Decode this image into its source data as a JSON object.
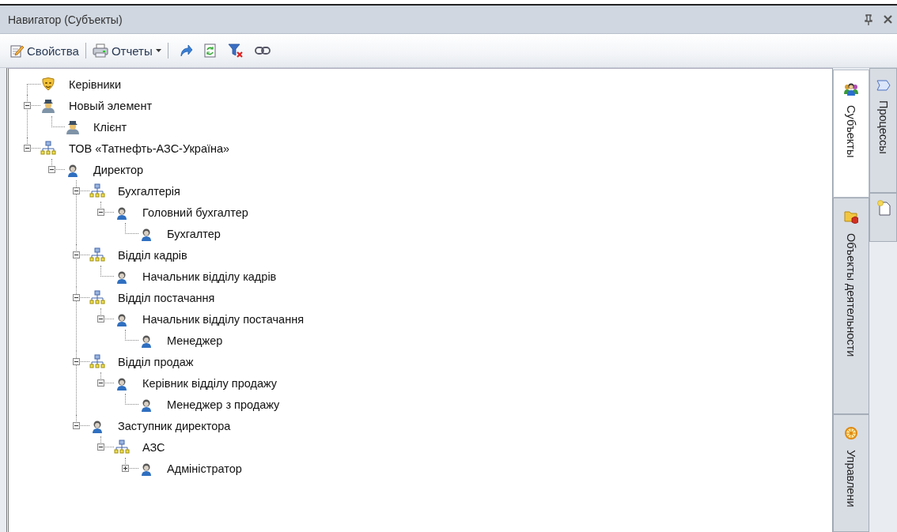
{
  "panel": {
    "title": "Навигатор (Субъекты)"
  },
  "toolbar": [
    {
      "kind": "labeled",
      "label": "Свойства"
    },
    {
      "kind": "dropdown",
      "label": "Отчеты"
    }
  ],
  "tree": [
    {
      "kind": "role",
      "label": "Керівники"
    },
    {
      "kind": "client",
      "label": "Новый элемент",
      "expanded": true,
      "children": [
        {
          "kind": "client",
          "label": "Клієнт"
        }
      ]
    },
    {
      "kind": "unit",
      "label": "ТОВ «Татнефть-АЗС-Україна»",
      "expanded": true,
      "children": [
        {
          "kind": "position",
          "label": "Директор",
          "expanded": true,
          "children": [
            {
              "kind": "unit",
              "label": "Бухгалтерія",
              "expanded": true,
              "children": [
                {
                  "kind": "position",
                  "label": "Головний бухгалтер",
                  "expanded": true,
                  "children": [
                    {
                      "kind": "position",
                      "label": "Бухгалтер"
                    }
                  ]
                }
              ]
            },
            {
              "kind": "unit",
              "label": "Відділ кадрів",
              "expanded": true,
              "children": [
                {
                  "kind": "position",
                  "label": "Начальник відділу кадрів"
                }
              ]
            },
            {
              "kind": "unit",
              "label": "Відділ постачання",
              "expanded": true,
              "children": [
                {
                  "kind": "position",
                  "label": "Начальник відділу постачання",
                  "expanded": true,
                  "children": [
                    {
                      "kind": "position",
                      "label": "Менеджер"
                    }
                  ]
                }
              ]
            },
            {
              "kind": "unit",
              "label": "Відділ продаж",
              "expanded": true,
              "children": [
                {
                  "kind": "position",
                  "label": "Керівник відділу продажу",
                  "expanded": true,
                  "children": [
                    {
                      "kind": "position",
                      "label": "Менеджер з продажу"
                    }
                  ]
                }
              ]
            },
            {
              "kind": "position",
              "label": "Заступник директора",
              "expanded": true,
              "children": [
                {
                  "kind": "unit",
                  "label": "АЗС",
                  "expanded": true,
                  "children": [
                    {
                      "kind": "position",
                      "label": "Адміністратор",
                      "expanded": false
                    }
                  ]
                }
              ]
            }
          ]
        }
      ]
    }
  ],
  "side_tabs": [
    {
      "kind": "subjects",
      "label": "Субъекты",
      "selected": true
    },
    {
      "kind": "objects",
      "label": "Объекты деятельности",
      "selected": false
    },
    {
      "kind": "control",
      "label": "Управлени",
      "selected": false
    }
  ],
  "side_tabs_2": [
    {
      "kind": "processes",
      "label": "Процессы",
      "selected": false
    },
    {
      "kind": "documents",
      "selected": false
    }
  ]
}
